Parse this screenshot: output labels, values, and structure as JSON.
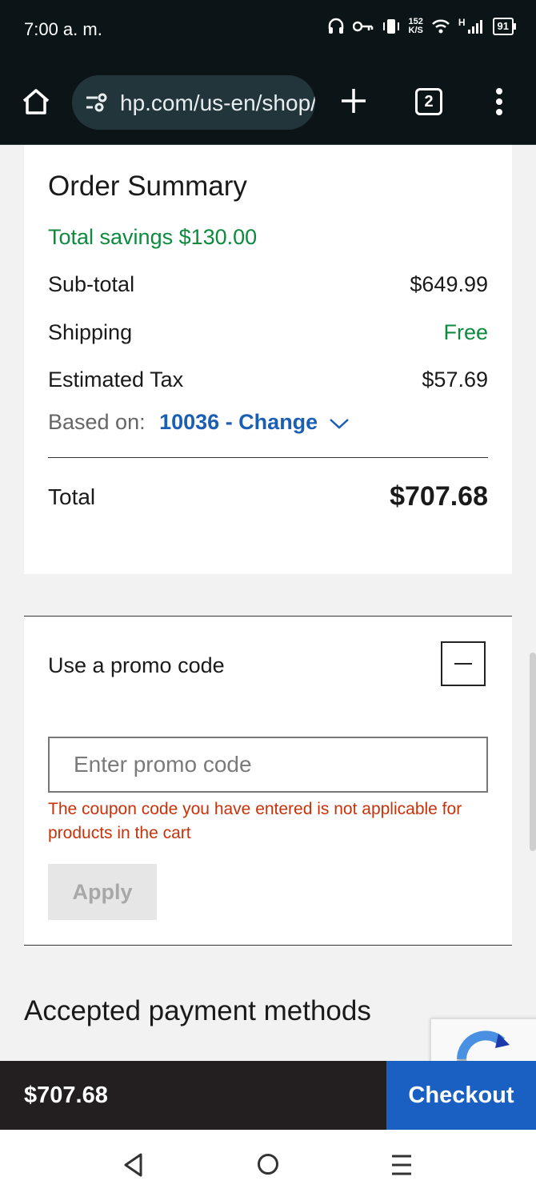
{
  "status_bar": {
    "time": "7:00 a. m.",
    "net_speed_value": "152",
    "net_speed_unit": "K/S",
    "network_type": "H",
    "battery": "91"
  },
  "browser": {
    "url": "hp.com/us-en/shop/cart",
    "tab_count": "2"
  },
  "order_summary": {
    "title": "Order Summary",
    "savings": "Total savings $130.00",
    "subtotal_label": "Sub-total",
    "subtotal_value": "$649.99",
    "shipping_label": "Shipping",
    "shipping_value": "Free",
    "tax_label": "Estimated Tax",
    "tax_value": "$57.69",
    "based_on_label": "Based on:",
    "zip_change": "10036 - Change",
    "total_label": "Total",
    "total_value": "$707.68"
  },
  "promo": {
    "title": "Use a promo code",
    "placeholder": "Enter promo code",
    "error": "The coupon code you have entered is not applicable for products in the cart",
    "apply_label": "Apply"
  },
  "payments_title": "Accepted payment methods",
  "checkout_bar": {
    "price": "$707.68",
    "checkout_label": "Checkout"
  },
  "colors": {
    "accent_blue": "#1960c2",
    "savings_green": "#0e8a3e",
    "error_red": "#c8320a",
    "dark_bar": "#231f20"
  }
}
